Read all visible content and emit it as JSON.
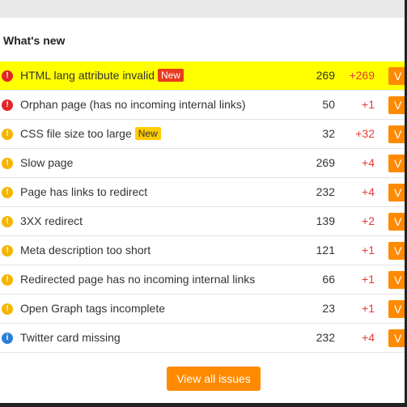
{
  "section": {
    "title": "What's new"
  },
  "severity_icons": {
    "error": "exclamation-icon",
    "warning": "exclamation-icon",
    "notice": "info-icon"
  },
  "colors": {
    "accent": "#ff8a00",
    "error": "#e02626",
    "warning": "#f5b400",
    "notice": "#2d7fd6",
    "delta": "#e53935",
    "highlight": "#ffff00"
  },
  "issues": [
    {
      "severity": "error",
      "icon_glyph": "!",
      "label": "HTML lang attribute invalid",
      "badge": "New",
      "badge_style": "red",
      "count": "269",
      "delta": "+269",
      "action": "V",
      "highlighted": true
    },
    {
      "severity": "error",
      "icon_glyph": "!",
      "label": "Orphan page (has no incoming internal links)",
      "badge": "",
      "badge_style": "",
      "count": "50",
      "delta": "+1",
      "action": "V",
      "highlighted": false
    },
    {
      "severity": "warning",
      "icon_glyph": "!",
      "label": "CSS file size too large",
      "badge": "New",
      "badge_style": "yellow",
      "count": "32",
      "delta": "+32",
      "action": "V",
      "highlighted": false
    },
    {
      "severity": "warning",
      "icon_glyph": "!",
      "label": "Slow page",
      "badge": "",
      "badge_style": "",
      "count": "269",
      "delta": "+4",
      "action": "V",
      "highlighted": false
    },
    {
      "severity": "warning",
      "icon_glyph": "!",
      "label": "Page has links to redirect",
      "badge": "",
      "badge_style": "",
      "count": "232",
      "delta": "+4",
      "action": "V",
      "highlighted": false
    },
    {
      "severity": "warning",
      "icon_glyph": "!",
      "label": "3XX redirect",
      "badge": "",
      "badge_style": "",
      "count": "139",
      "delta": "+2",
      "action": "V",
      "highlighted": false
    },
    {
      "severity": "warning",
      "icon_glyph": "!",
      "label": "Meta description too short",
      "badge": "",
      "badge_style": "",
      "count": "121",
      "delta": "+1",
      "action": "V",
      "highlighted": false
    },
    {
      "severity": "warning",
      "icon_glyph": "!",
      "label": "Redirected page has no incoming internal links",
      "badge": "",
      "badge_style": "",
      "count": "66",
      "delta": "+1",
      "action": "V",
      "highlighted": false
    },
    {
      "severity": "warning",
      "icon_glyph": "!",
      "label": "Open Graph tags incomplete",
      "badge": "",
      "badge_style": "",
      "count": "23",
      "delta": "+1",
      "action": "V",
      "highlighted": false
    },
    {
      "severity": "notice",
      "icon_glyph": "i",
      "label": "Twitter card missing",
      "badge": "",
      "badge_style": "",
      "count": "232",
      "delta": "+4",
      "action": "V",
      "highlighted": false
    }
  ],
  "footer": {
    "view_all_label": "View all issues"
  }
}
